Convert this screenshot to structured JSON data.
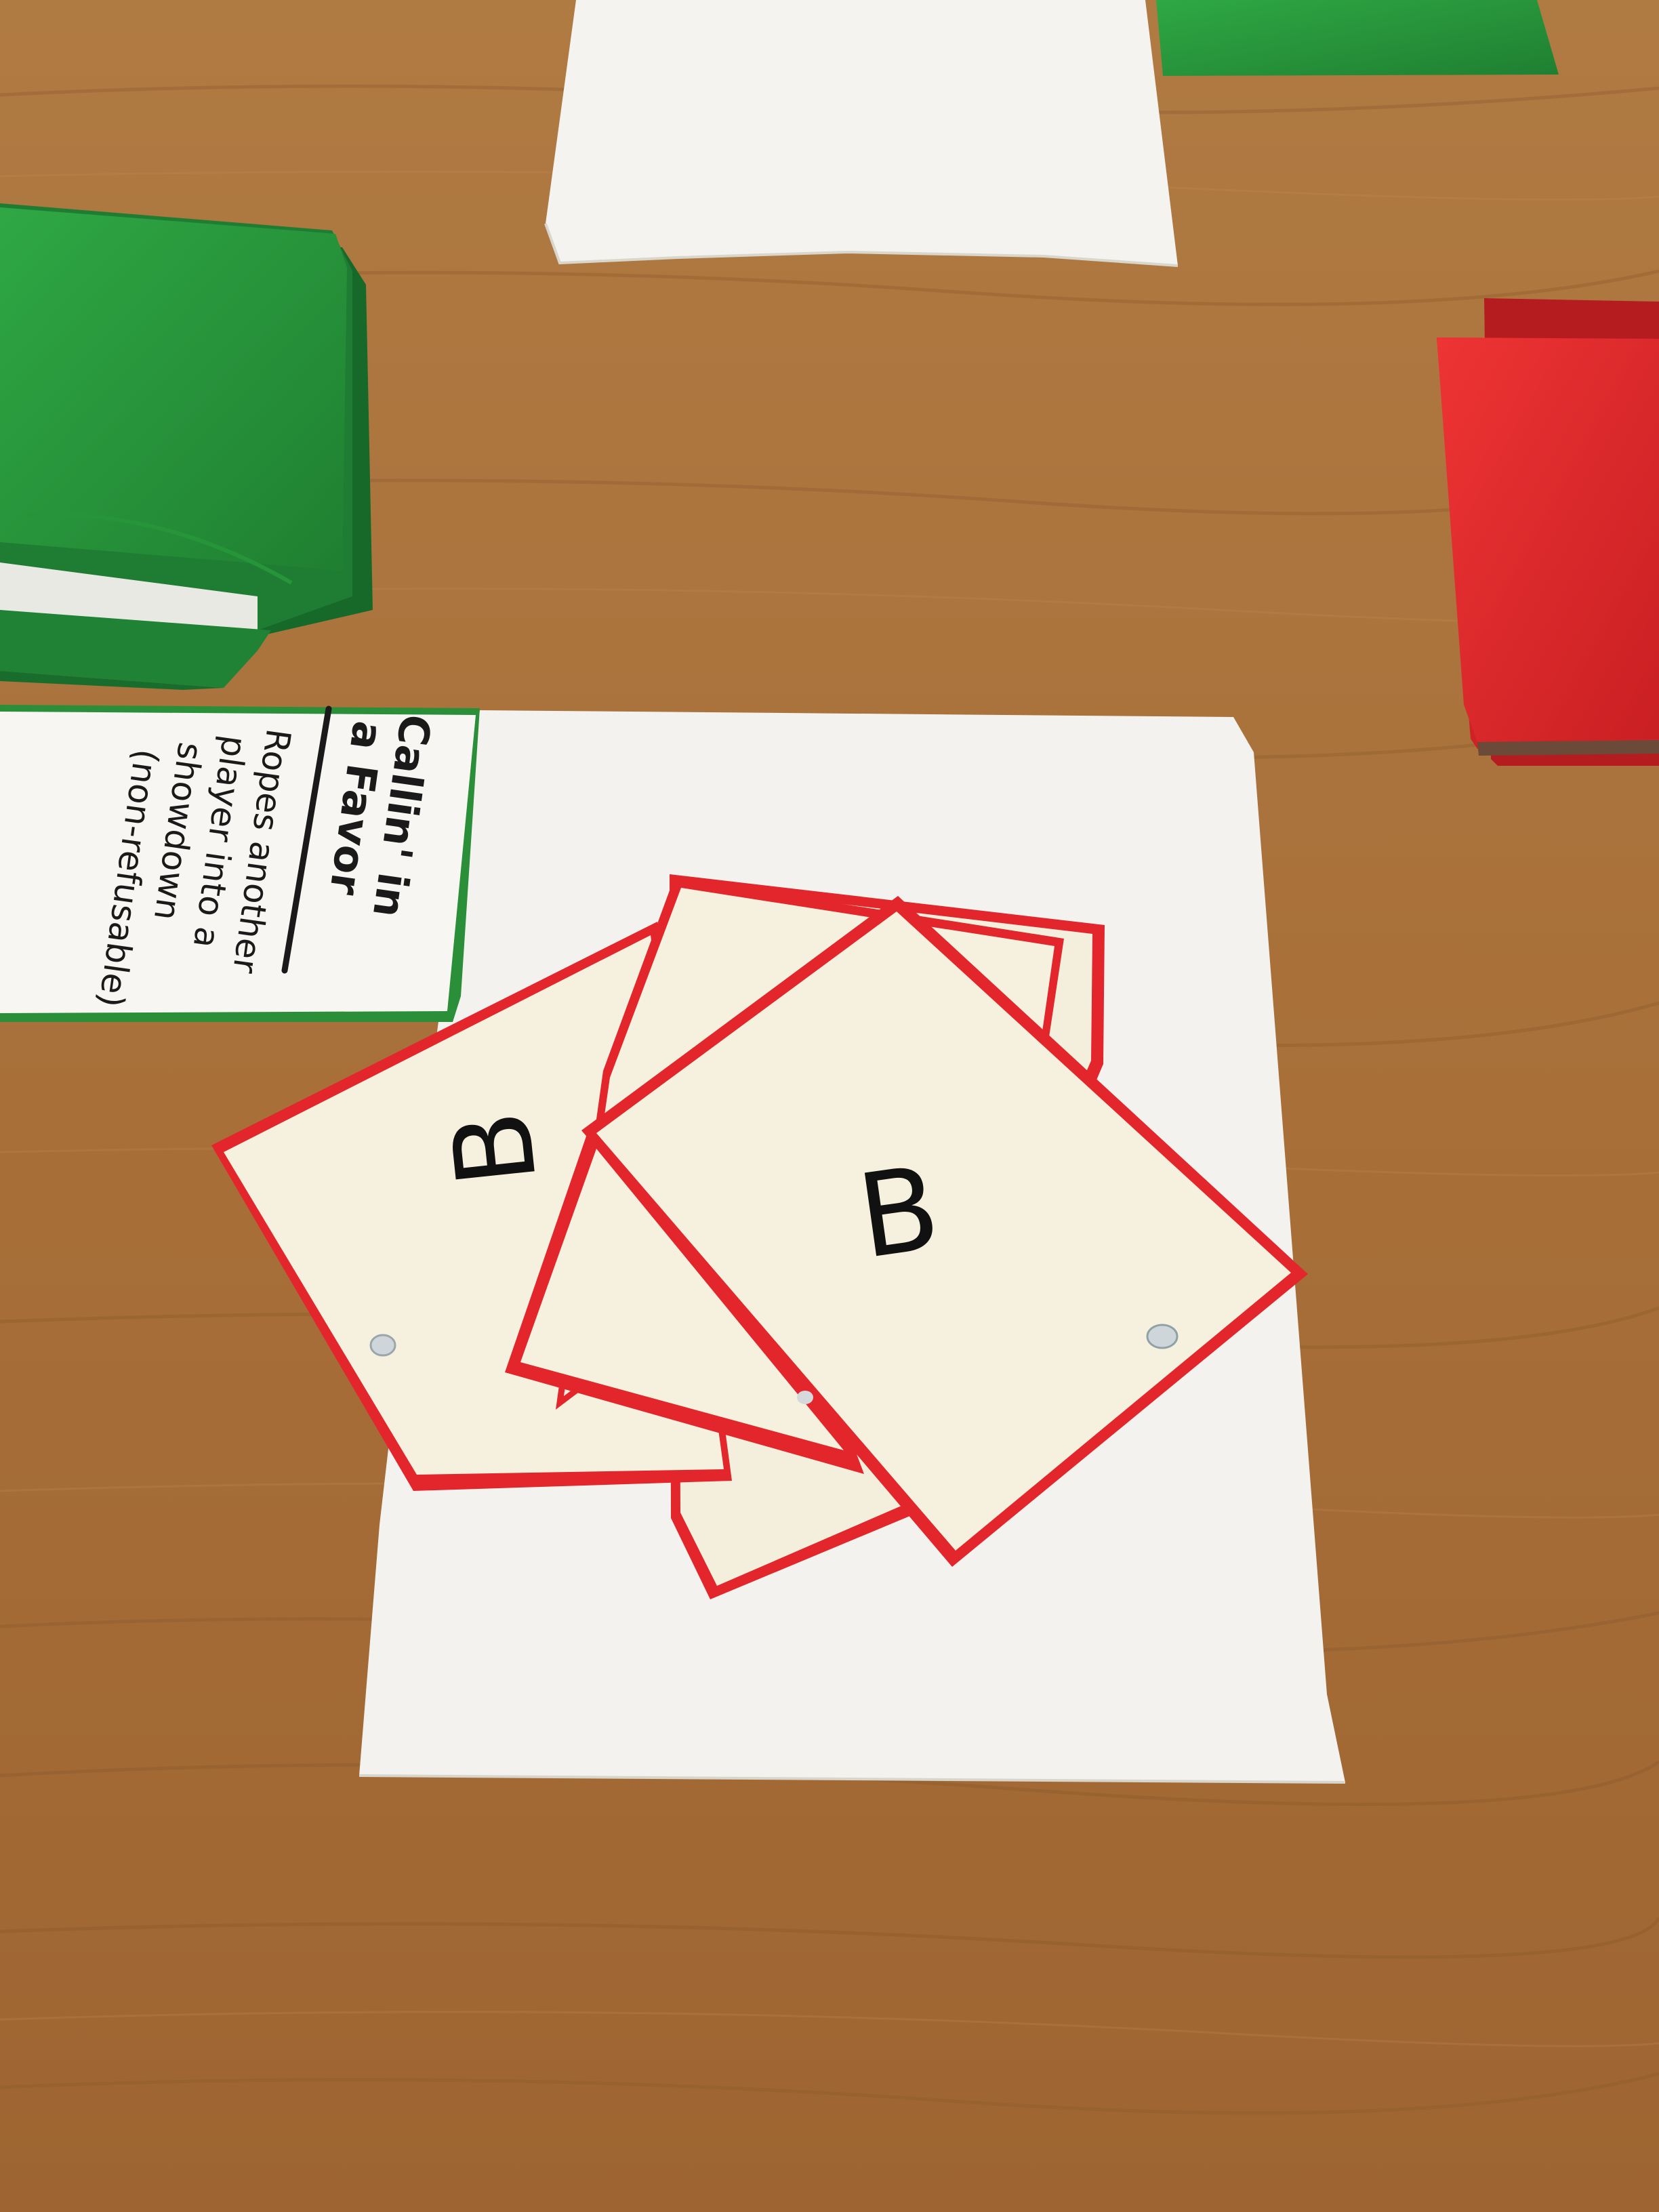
{
  "scene": {
    "kind": "photo-tabletop-card-game",
    "table_color": "#a9743f",
    "table_grain_color": "#8a5a2c"
  },
  "favor_card": {
    "title_line1": "Callin' in",
    "title_line2": "a Favor",
    "body_line1": "Ropes another",
    "body_line2": "player into a",
    "body_line3": "showdown",
    "body_line4": "(non-refusable)",
    "face_color": "#f7f6f2",
    "border_color": "#2f8f3a"
  },
  "letter_cards": {
    "count": 4,
    "face_color": "#f6f1de",
    "border_color": "#e3262b",
    "top_card_letter": "B",
    "left_card_letter": "B"
  },
  "decks": {
    "green_color": "#2a9a3c",
    "red_color": "#e02a2a",
    "paper_color": "#f4f3ef"
  }
}
